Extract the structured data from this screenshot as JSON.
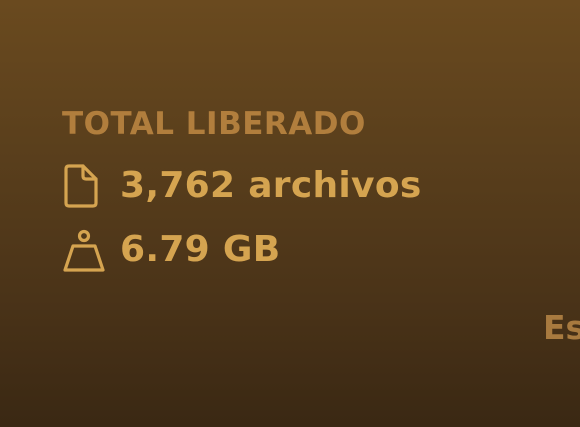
{
  "summary": {
    "title": "TOTAL LIBERADO",
    "files": {
      "icon": "document-icon",
      "value": "3,762 archivos"
    },
    "size": {
      "icon": "weight-icon",
      "value": "6.79 GB"
    }
  },
  "partial_label": "Es",
  "colors": {
    "title": "#b17e3d",
    "value": "#d5a450",
    "background_top": "#6a4a1f",
    "background_bottom": "#3a2813"
  }
}
